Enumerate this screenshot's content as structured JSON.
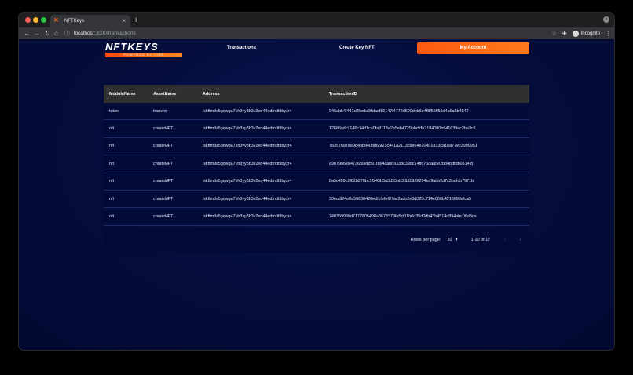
{
  "browser": {
    "tab_title": "NFTKeys",
    "tab_favicon": "K",
    "tab_close": "×",
    "new_tab": "+",
    "url_host": "localhost",
    "url_path": ":3000/transactions",
    "incognito_label": "Incognito",
    "colors": {
      "tabbar": "#1f1f22",
      "toolbar": "#35363a",
      "red": "#ff5f57",
      "yellow": "#febc2e",
      "green": "#28c840"
    }
  },
  "header": {
    "logo_text": "NFTKEYS",
    "logo_tagline": "POWERED BY LISK",
    "nav_transactions": "Transactions",
    "nav_create": "Create Key NFT",
    "account_button": "My Account",
    "accent": "#ff6a14"
  },
  "table": {
    "columns": [
      "ModuleName",
      "AssetName",
      "Address",
      "TransactionID"
    ],
    "rows": [
      [
        "token",
        "transfer",
        "lskftm9s5gqwga7kh3yy3b3v2eq44edfndt9byzr4",
        "945ab54f441c88eda6ffdacf15147f4778d590dbb6e4f8f55ff56d4a6a5b4842"
      ],
      [
        "nft",
        "createNFT",
        "lskftm9s5gqwga7kh3yy3b3v2eq44edfndt9byzr4",
        "12666cdc9146c34d1ca0fa9113a2e5eb4729bbdfdb2184080b641639ec2ba3c6"
      ],
      [
        "nft",
        "createNFT",
        "lskftm9s5gqwga7kh3yy3b3v2eq44edfndt9byzr4",
        "783576870e9d4b8d40bd66f21c441a2113c8e64e20401833ca1ea77ec3909951"
      ],
      [
        "nft",
        "createNFT",
        "lskftm9s5gqwga7kh3yy3b3v2eq44edfndt9byzr4",
        "a907906e8473639eb591fa64cab69338c39dc14ffc76daa5e2bb4bdfdb0614f8"
      ],
      [
        "nft",
        "createNFT",
        "lskftm9s5gqwga7kh3yy3b3v2eq44edfndt9byzr4",
        "8a5c459c8f82b276bc1f245b3a3d33bb36b83b0f294bc9abb2d7c3bdfcb7971b"
      ],
      [
        "nft",
        "createNFT",
        "lskftm9s5gqwga7kh3yy3b3v2eq44edfndt9byzr4",
        "30ecdf24e2e56630426edfcfefe6f7ac2acb2e3d025c714e086b4216699afca5"
      ],
      [
        "nft",
        "createNFT",
        "lskftm9s5gqwga7kh3yy3b3v2eq44edfndt9byzr4",
        "740359998d7177805498a3678379fe5cf11b0d35d0db43b4514d894abc06d8ca"
      ]
    ]
  },
  "pagination": {
    "rows_per_page_label": "Rows per page:",
    "rows_per_page_value": "10",
    "range": "1-10 of 17",
    "prev": "‹",
    "next": "›"
  }
}
